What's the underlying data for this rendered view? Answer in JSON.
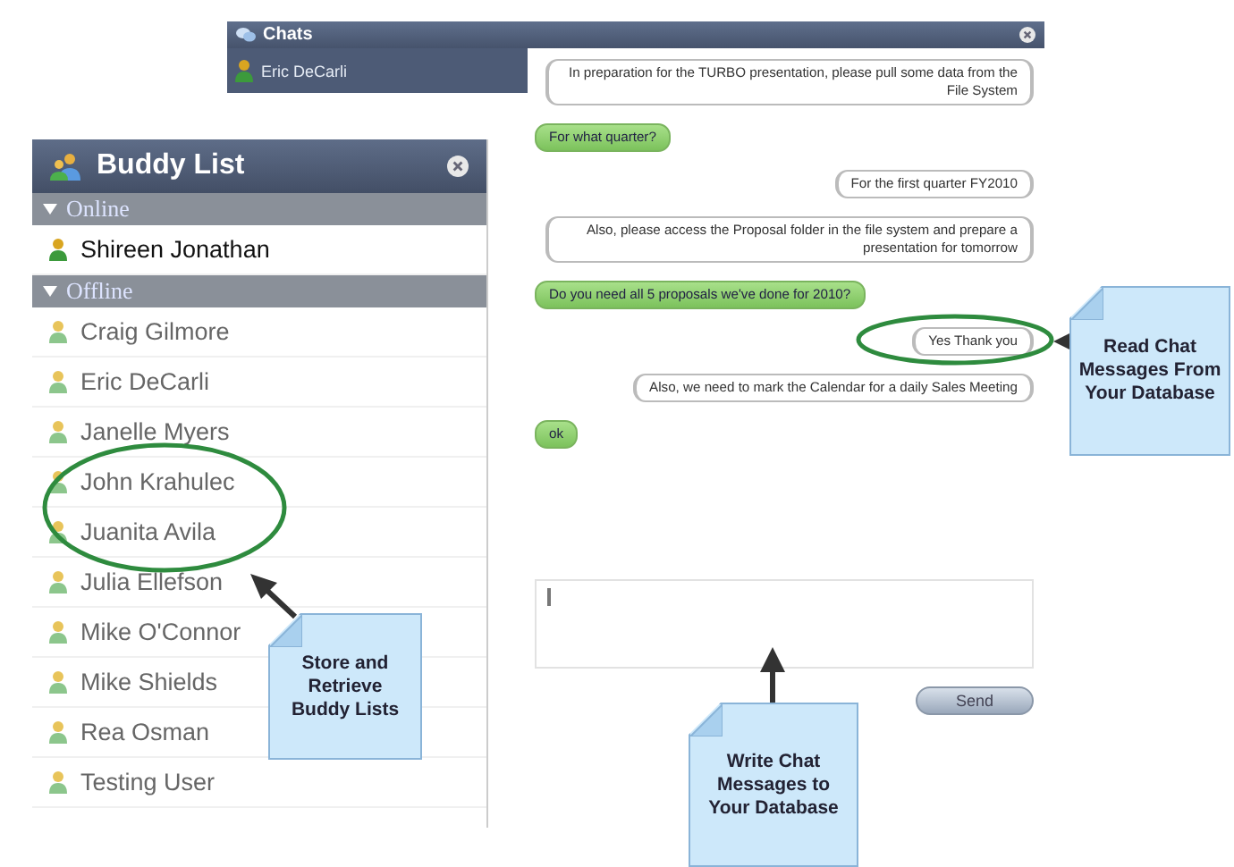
{
  "chats_window": {
    "title": "Chats",
    "conversations": [
      {
        "name": "Eric DeCarli",
        "selected": true
      }
    ],
    "messages": [
      {
        "kind": "received",
        "text": "In preparation for the TURBO presentation, please pull some data from the File System"
      },
      {
        "kind": "sent",
        "text": "For what quarter?"
      },
      {
        "kind": "received",
        "text": "For the first quarter FY2010"
      },
      {
        "kind": "received",
        "text": "Also, please access the Proposal folder in the file system and prepare a presentation for tomorrow"
      },
      {
        "kind": "sent",
        "text": "Do you need all 5 proposals we've done for 2010?"
      },
      {
        "kind": "received",
        "text": "Yes  Thank you"
      },
      {
        "kind": "received",
        "text": "Also, we need to mark the Calendar for a daily Sales Meeting"
      },
      {
        "kind": "sent",
        "text": "ok"
      }
    ],
    "send_button": "Send"
  },
  "buddy_list": {
    "title": "Buddy List",
    "groups": [
      {
        "label": "Online",
        "expanded": true,
        "buddies": [
          {
            "name": "Shireen Jonathan",
            "online": true
          }
        ]
      },
      {
        "label": "Offline",
        "expanded": true,
        "buddies": [
          {
            "name": "Craig Gilmore",
            "online": false
          },
          {
            "name": "Eric DeCarli",
            "online": false
          },
          {
            "name": "Janelle Myers",
            "online": false
          },
          {
            "name": "John Krahulec",
            "online": false
          },
          {
            "name": "Juanita Avila",
            "online": false
          },
          {
            "name": "Julia Ellefson",
            "online": false
          },
          {
            "name": "Mike O'Connor",
            "online": false
          },
          {
            "name": "Mike Shields",
            "online": false
          },
          {
            "name": "Rea Osman",
            "online": false
          },
          {
            "name": "Testing User",
            "online": false
          }
        ]
      }
    ]
  },
  "annotations": [
    {
      "text": "Read Chat Messages From Your Database"
    },
    {
      "text": "Store and Retrieve Buddy Lists"
    },
    {
      "text": "Write Chat Messages to Your Database"
    }
  ]
}
